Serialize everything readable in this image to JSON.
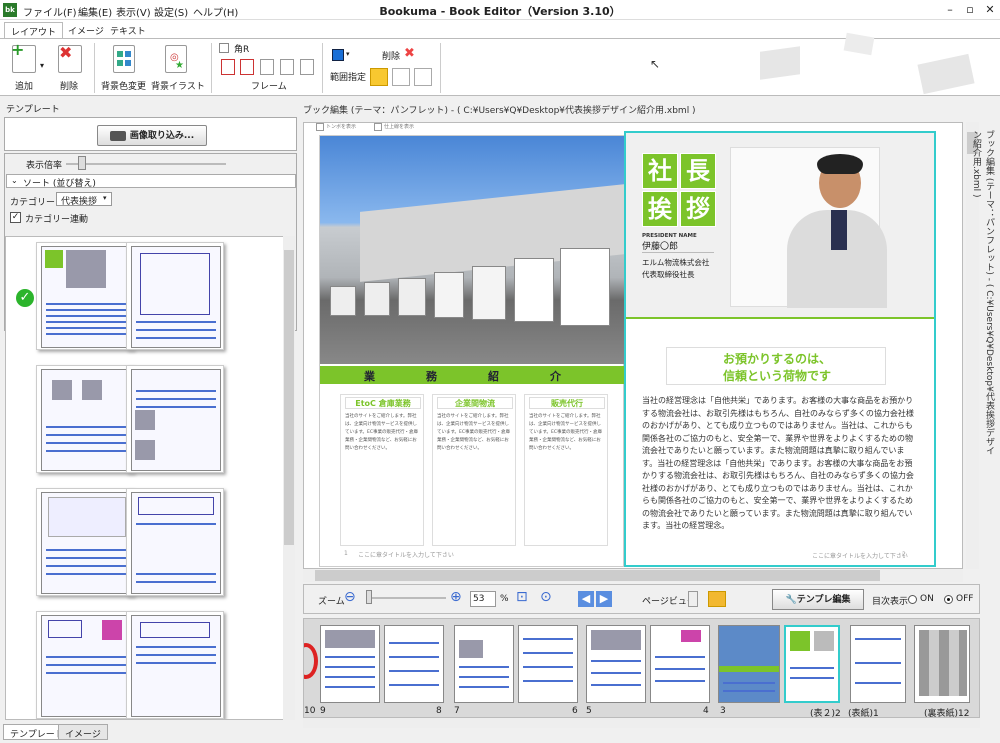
{
  "window": {
    "title": "Bookuma - Book Editor（Version 3.10）",
    "app_icon": "bk"
  },
  "menu": [
    "ファイル(F)",
    "編集(E)",
    "表示(V)",
    "設定(S)",
    "ヘルプ(H)"
  ],
  "ribbon_tabs": [
    "レイアウト",
    "イメージ",
    "テキスト"
  ],
  "ribbon": {
    "add": "追加",
    "delete": "削除",
    "bg_color": "背景色変更",
    "bg_illust": "背景イラスト",
    "corner_r": "角R",
    "frame": "フレーム",
    "range_select": "範囲指定",
    "range_delete": "削除"
  },
  "left_panel": {
    "header": "テンプレート",
    "import_button": "画像取り込み...",
    "zoom_label": "表示倍率",
    "sort_label": "ソート (並び替え)",
    "category_label": "カテゴリー",
    "category_value": "代表挨拶",
    "category_link": "カテゴリー連動",
    "tabs": [
      "テンプレート",
      "イメージ"
    ]
  },
  "editor": {
    "header": "ブック編集 (テーマ：パンフレット) - ( C:¥Users¥Q¥Desktop¥代表挨拶デザイン紹介用.xbml )",
    "side_caption": "ブック編集 (テーマ：パンフレット) - ( C:¥Users¥Q¥Desktop¥代表挨拶デザイン紹介用.xbml )",
    "show_mark": "トンボを表示",
    "show_guide": "仕上線を表示"
  },
  "document": {
    "section_title": "業　務　紹　介",
    "col_titles": [
      "EtoC 倉庫業務",
      "企業間物流",
      "販売代行"
    ],
    "col_text": "当社のサイトをご紹介します。弊社は、企業向け物流サービスを提供しています。EC事業の販売代行・倉庫業務・企業間物流など、お気軽にお問い合わせください。",
    "footer_left": "ここに章タイトルを入力して下さい",
    "footer_right": "ここに章タイトルを入力して下さい",
    "page_left_num": "1",
    "page_right_num": "2",
    "greeting_chars": [
      "社",
      "長",
      "挨",
      "拶"
    ],
    "president_label": "PRESIDENT NAME",
    "president_name": "伊藤〇郎",
    "company": "エルム物流株式会社",
    "role": "代表取締役社長",
    "headline1": "お預かりするのは、",
    "headline2": "信頼という荷物です",
    "body": "当社の経営理念は「自他共栄」であります。お客様の大事な商品をお預かりする物流会社は、お取引先様はもちろん、自社のみならず多くの協力会社様のおかげがあり、とても成り立つものではありません。当社は、これからも関係各社のご協力のもと、安全第一で、業界や世界をよりよくするための物流会社でありたいと願っています。また物流問題は真摯に取り組んでいます。当社の経営理念は「自他共栄」であります。お客様の大事な商品をお預かりする物流会社は、お取引先様はもちろん、自社のみならず多くの協力会社様のおかげがあり、とても成り立つものではありません。当社は、これからも関係各社のご協力のもと、安全第一で、業界や世界をよりよくするための物流会社でありたいと願っています。また物流問題は真摯に取り組んでいます。当社の経営理念。"
  },
  "zoom_bar": {
    "zoom_label": "ズーム",
    "zoom_value": "53",
    "percent": "%",
    "page_view": "ページビュー",
    "template_edit": "テンプレ編集",
    "toc_label": "目次表示",
    "on": "ON",
    "off": "OFF",
    "toc_selected": "OFF"
  },
  "filmstrip": {
    "labels": [
      "10",
      "9",
      "8",
      "7",
      "6",
      "5",
      "4",
      "3",
      "(表２)2",
      "(表紙)1",
      "(裏表紙)12"
    ]
  },
  "colors": {
    "accent_green": "#7cc42a",
    "selection_cyan": "#33cccc",
    "ribbon_blue": "#1a6fd6"
  }
}
